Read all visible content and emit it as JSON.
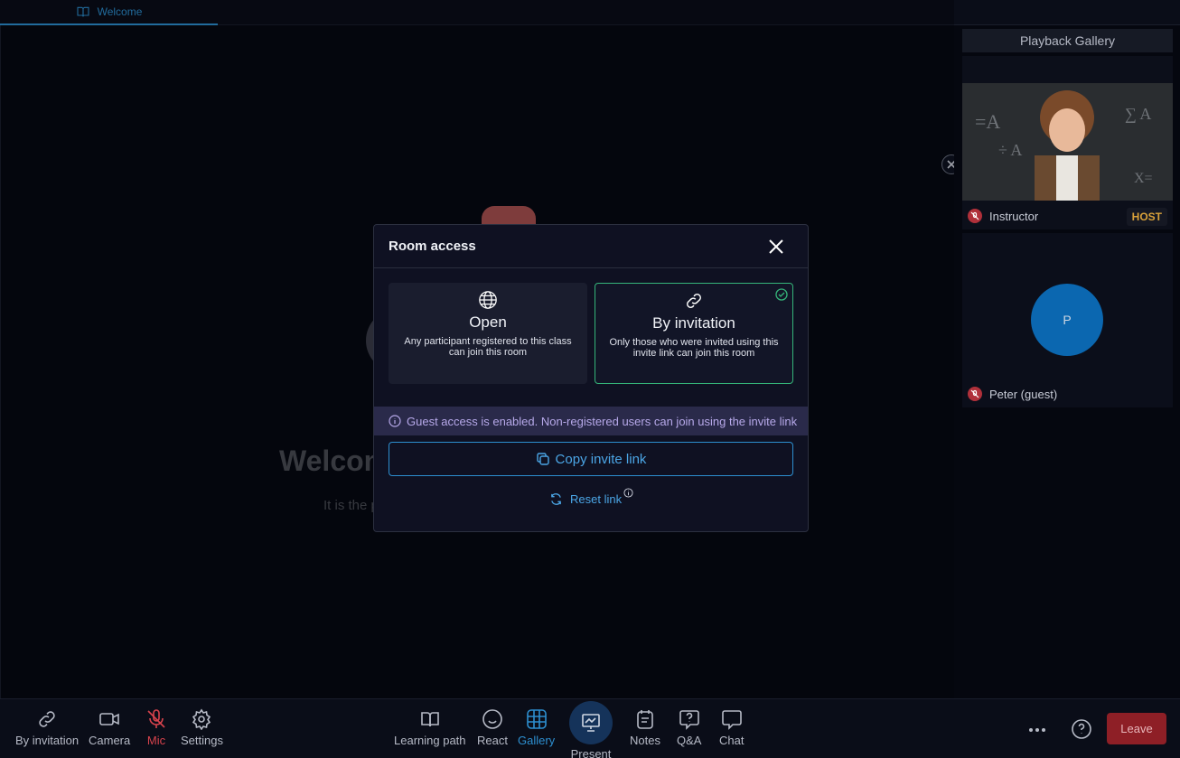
{
  "tab": {
    "label": "Welcome"
  },
  "stage": {
    "title": "Welcom",
    "subtitle": "It is the p"
  },
  "gallery": {
    "title": "Playback Gallery",
    "tiles": [
      {
        "name": "Instructor",
        "badge": "HOST",
        "mic_muted": true
      },
      {
        "name": "Peter (guest)",
        "initial": "P",
        "mic_muted": true
      }
    ]
  },
  "modal": {
    "title": "Room access",
    "options": [
      {
        "title": "Open",
        "description": "Any participant registered to this class can join this room",
        "selected": false
      },
      {
        "title": "By invitation",
        "description": "Only those who were invited using this invite link can join this room",
        "selected": true
      }
    ],
    "info": "Guest access is enabled. Non-registered users can join using the invite link",
    "copy_label": "Copy invite link",
    "reset_label": "Reset link"
  },
  "toolbar": {
    "left": [
      {
        "label": "By invitation"
      },
      {
        "label": "Camera"
      },
      {
        "label": "Mic",
        "state": "muted"
      },
      {
        "label": "Settings"
      }
    ],
    "center": [
      {
        "label": "Learning path"
      },
      {
        "label": "React"
      },
      {
        "label": "Gallery",
        "active": true
      },
      {
        "label": "Present"
      },
      {
        "label": "Notes"
      },
      {
        "label": "Q&A"
      },
      {
        "label": "Chat"
      }
    ],
    "leave_label": "Leave"
  },
  "colors": {
    "accent": "#2d8fd0",
    "success": "#35b57a",
    "danger": "#8e1f26",
    "host": "#d9a13a"
  }
}
